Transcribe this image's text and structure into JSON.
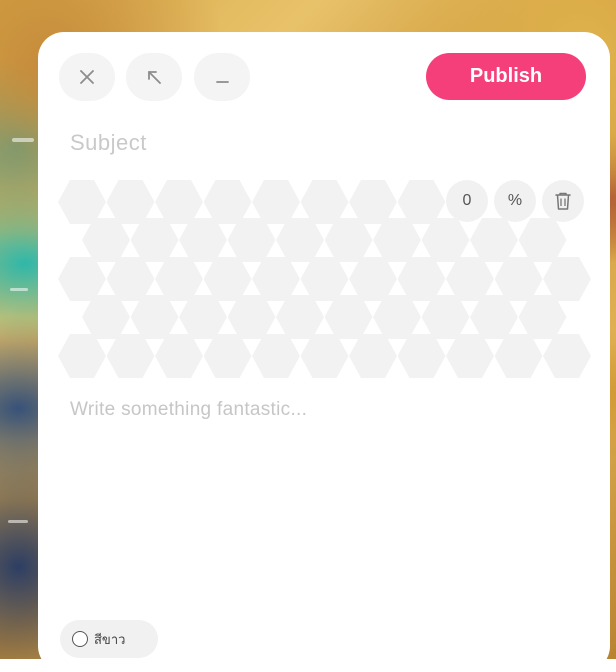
{
  "toolbar": {
    "close_icon": "close-icon",
    "expand_icon": "arrow-up-left-icon",
    "minimize_icon": "minimize-icon",
    "publish_label": "Publish"
  },
  "editor": {
    "subject_placeholder": "Subject",
    "body_placeholder": "Write something fantastic..."
  },
  "hex_panel": {
    "value": "0",
    "unit": "%",
    "delete_icon": "trash-icon"
  },
  "footer": {
    "theme_label": "สีขาว"
  },
  "colors": {
    "accent": "#f43f7a",
    "panel": "#ffffff",
    "hex_fill": "#f2f2f2",
    "placeholder": "#c6c6c6"
  }
}
